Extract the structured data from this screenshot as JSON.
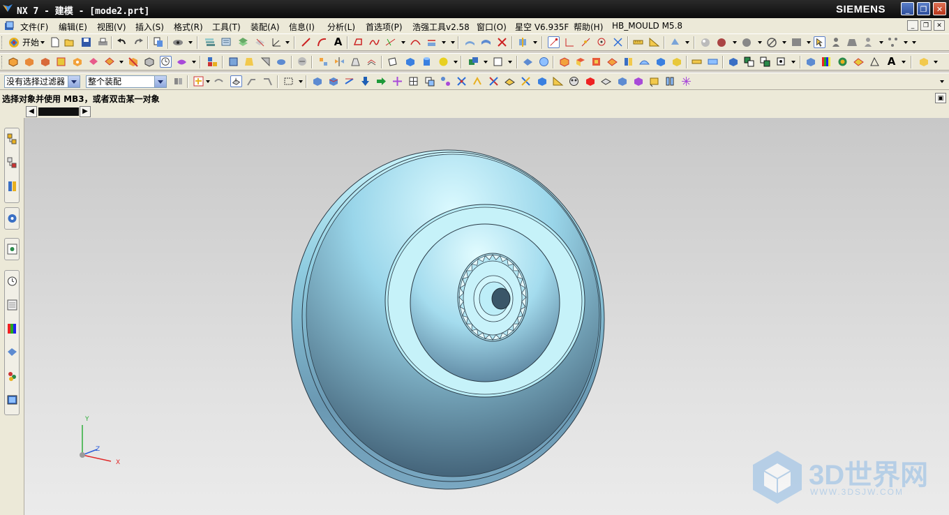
{
  "window": {
    "title": "NX 7 - 建模 - [mode2.prt]",
    "brand": "SIEMENS",
    "min_glyph": "_",
    "max_glyph": "❐",
    "close_glyph": "✕"
  },
  "menu": {
    "items": [
      {
        "label": "文件(F)"
      },
      {
        "label": "编辑(E)"
      },
      {
        "label": "视图(V)"
      },
      {
        "label": "插入(S)"
      },
      {
        "label": "格式(R)"
      },
      {
        "label": "工具(T)"
      },
      {
        "label": "装配(A)"
      },
      {
        "label": "信息(I)"
      },
      {
        "label": "分析(L)"
      },
      {
        "label": "首选项(P)"
      },
      {
        "label": "浩强工具v2.58"
      },
      {
        "label": "窗口(O)"
      },
      {
        "label": "星空 V6.935F"
      },
      {
        "label": "帮助(H)"
      },
      {
        "label": "HB_MOULD M5.8"
      }
    ]
  },
  "toolbar1": {
    "start_label": "开始"
  },
  "filters": {
    "type_filter": "没有选择过滤器",
    "scope_filter": "整个装配"
  },
  "cue_line": "选择对象并使用 MB3，或者双击某一对象",
  "triad": {
    "y": "Y",
    "z": "Z",
    "x": "X"
  },
  "watermark": {
    "text": "3D世界网",
    "url": "WWW.3DSJW.COM"
  },
  "colors": {
    "titlebar": "#111111",
    "toolbar_bg": "#ece9d8",
    "part_light": "#b9ecf7",
    "part_dark": "#3f5d73",
    "viewport_top": "#c8c8c8",
    "viewport_bottom": "#ebebeb"
  }
}
